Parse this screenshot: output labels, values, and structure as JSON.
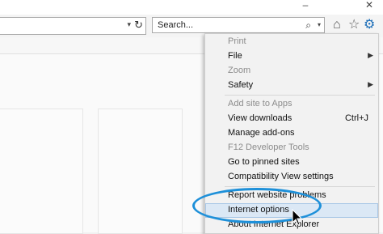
{
  "window": {
    "minimize": "–",
    "close": "✕"
  },
  "address": {
    "dropdown_glyph": "▾",
    "refresh_glyph": "↻"
  },
  "search": {
    "placeholder": "Search...",
    "search_glyph": "⌕",
    "dropdown_glyph": "▾"
  },
  "toolbar": {
    "home_glyph": "⌂",
    "favorites_glyph": "☆",
    "tools_glyph": "⚙"
  },
  "menu": {
    "items": [
      {
        "label": "Print",
        "disabled": true
      },
      {
        "label": "File",
        "arrow": "▶"
      },
      {
        "label": "Zoom",
        "disabled": true
      },
      {
        "label": "Safety",
        "arrow": "▶"
      },
      {
        "label": "Add site to Apps",
        "disabled": true
      },
      {
        "label": "View downloads",
        "shortcut": "Ctrl+J"
      },
      {
        "label": "Manage add-ons"
      },
      {
        "label": "F12 Developer Tools",
        "disabled": true
      },
      {
        "label": "Go to pinned sites"
      },
      {
        "label": "Compatibility View settings"
      },
      {
        "label": "Report website problems"
      },
      {
        "label": "Internet options",
        "highlighted": true
      },
      {
        "label": "About Internet Explorer"
      }
    ]
  },
  "colors": {
    "highlight_circle": "#1e90d9",
    "tools_icon": "#1e6fb8"
  }
}
